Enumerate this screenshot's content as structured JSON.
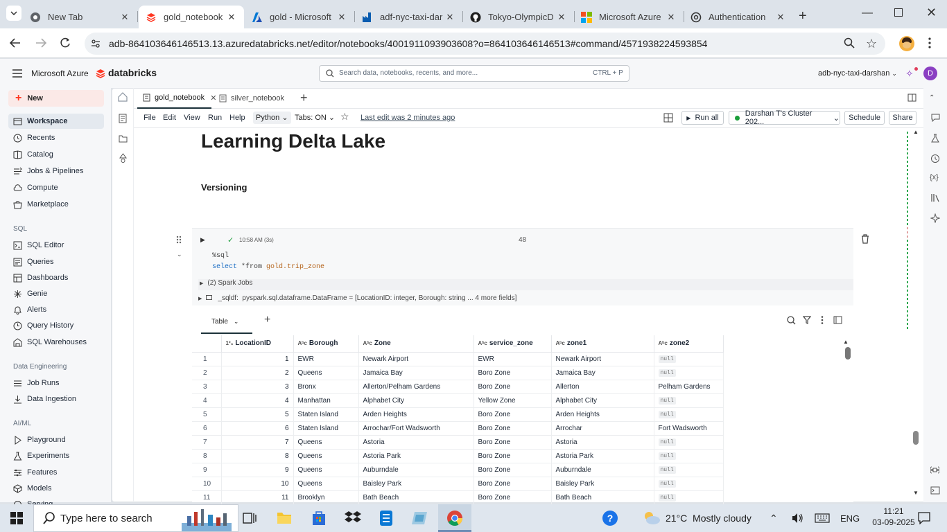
{
  "browser": {
    "tabs": [
      {
        "title": "New Tab",
        "icon": "chrome-icon",
        "active": false
      },
      {
        "title": "gold_notebook",
        "icon": "databricks-icon",
        "active": true
      },
      {
        "title": "gold - Microsoft",
        "icon": "azure-icon",
        "active": false
      },
      {
        "title": "adf-nyc-taxi-dar",
        "icon": "data-factory-icon",
        "active": false
      },
      {
        "title": "Tokyo-OlympicD",
        "icon": "github-icon",
        "active": false
      },
      {
        "title": "Microsoft Azure",
        "icon": "microsoft-icon",
        "active": false
      },
      {
        "title": "Authentication",
        "icon": "openai-icon",
        "active": false
      }
    ],
    "url": "adb-864103646146513.13.azuredatabricks.net/editor/notebooks/4001911093903608?o=864103646146513#command/4571938224593854"
  },
  "header": {
    "azure_label": "Microsoft Azure",
    "brand": "databricks",
    "search_placeholder": "Search data, notebooks, recents, and more...",
    "search_shortcut": "CTRL + P",
    "workspace": "adb-nyc-taxi-darshan",
    "avatar_letter": "D"
  },
  "sidebar": {
    "new_label": "New",
    "items": [
      {
        "label": "Workspace",
        "icon": "workspace-icon",
        "selected": true
      },
      {
        "label": "Recents",
        "icon": "clock-icon"
      },
      {
        "label": "Catalog",
        "icon": "catalog-icon"
      },
      {
        "label": "Jobs & Pipelines",
        "icon": "jobs-icon"
      },
      {
        "label": "Compute",
        "icon": "cloud-icon"
      },
      {
        "label": "Marketplace",
        "icon": "marketplace-icon"
      }
    ],
    "sql_section": "SQL",
    "sql_items": [
      {
        "label": "SQL Editor",
        "icon": "sql-editor-icon"
      },
      {
        "label": "Queries",
        "icon": "queries-icon"
      },
      {
        "label": "Dashboards",
        "icon": "dashboards-icon"
      },
      {
        "label": "Genie",
        "icon": "genie-icon"
      },
      {
        "label": "Alerts",
        "icon": "bell-icon"
      },
      {
        "label": "Query History",
        "icon": "history-icon"
      },
      {
        "label": "SQL Warehouses",
        "icon": "warehouse-icon"
      }
    ],
    "de_section": "Data Engineering",
    "de_items": [
      {
        "label": "Job Runs",
        "icon": "job-runs-icon"
      },
      {
        "label": "Data Ingestion",
        "icon": "ingestion-icon"
      }
    ],
    "ml_section": "AI/ML",
    "ml_items": [
      {
        "label": "Playground",
        "icon": "playground-icon"
      },
      {
        "label": "Experiments",
        "icon": "experiments-icon"
      },
      {
        "label": "Features",
        "icon": "features-icon"
      },
      {
        "label": "Models",
        "icon": "models-icon"
      },
      {
        "label": "Serving",
        "icon": "serving-icon"
      }
    ]
  },
  "notebook": {
    "tabs": [
      "gold_notebook",
      "silver_notebook"
    ],
    "menu": [
      "File",
      "Edit",
      "View",
      "Run",
      "Help"
    ],
    "language": "Python",
    "tabs_toggle": "Tabs: ON",
    "last_edit": "Last edit was 2 minutes ago",
    "run_all": "Run all",
    "cluster": "Darshan T's Cluster 202...",
    "schedule": "Schedule",
    "share": "Share",
    "heading": "Learning Delta Lake",
    "subheading": "Versioning"
  },
  "cell": {
    "run_time": "10:58 AM (3s)",
    "cell_number": "48",
    "code_line1": "%sql",
    "code_kw": "select",
    "code_rest": " *from ",
    "code_table": "gold.trip_zone",
    "spark_jobs": "(2) Spark Jobs",
    "df_name": "_sqldf:",
    "df_schema": "pyspark.sql.dataframe.DataFrame = [LocationID: integer, Borough: string ... 4 more fields]",
    "result_tab": "Table"
  },
  "table": {
    "columns": [
      "LocationID",
      "Borough",
      "Zone",
      "service_zone",
      "zone1",
      "zone2"
    ],
    "column_icons": [
      "1²₃",
      "Aᵇc",
      "Aᵇc",
      "Aᵇc",
      "Aᵇc",
      "Aᵇc"
    ],
    "null_label": "null",
    "rows": [
      [
        "1",
        "1",
        "EWR",
        "Newark Airport",
        "EWR",
        "Newark Airport",
        null
      ],
      [
        "2",
        "2",
        "Queens",
        "Jamaica Bay",
        "Boro Zone",
        "Jamaica Bay",
        null
      ],
      [
        "3",
        "3",
        "Bronx",
        "Allerton/Pelham Gardens",
        "Boro Zone",
        "Allerton",
        "Pelham Gardens"
      ],
      [
        "4",
        "4",
        "Manhattan",
        "Alphabet City",
        "Yellow Zone",
        "Alphabet City",
        null
      ],
      [
        "5",
        "5",
        "Staten Island",
        "Arden Heights",
        "Boro Zone",
        "Arden Heights",
        null
      ],
      [
        "6",
        "6",
        "Staten Island",
        "Arrochar/Fort Wadsworth",
        "Boro Zone",
        "Arrochar",
        "Fort Wadsworth"
      ],
      [
        "7",
        "7",
        "Queens",
        "Astoria",
        "Boro Zone",
        "Astoria",
        null
      ],
      [
        "8",
        "8",
        "Queens",
        "Astoria Park",
        "Boro Zone",
        "Astoria Park",
        null
      ],
      [
        "9",
        "9",
        "Queens",
        "Auburndale",
        "Boro Zone",
        "Auburndale",
        null
      ],
      [
        "10",
        "10",
        "Queens",
        "Baisley Park",
        "Boro Zone",
        "Baisley Park",
        null
      ],
      [
        "11",
        "11",
        "Brooklyn",
        "Bath Beach",
        "Boro Zone",
        "Bath Beach",
        null
      ]
    ]
  },
  "taskbar": {
    "search_placeholder": "Type here to search",
    "weather": "21°C  Mostly cloudy",
    "lang": "ENG",
    "time": "11:21",
    "date": "03-09-2025"
  },
  "colors": {
    "databricks_red": "#ff3621",
    "new_button_bg": "#fbe9e7",
    "chrome_tab_strip": "#dde3ea",
    "taskbar": "#dfe6ee",
    "success_green": "#1a9e3a",
    "avatar_purple": "#8a3fc2"
  }
}
